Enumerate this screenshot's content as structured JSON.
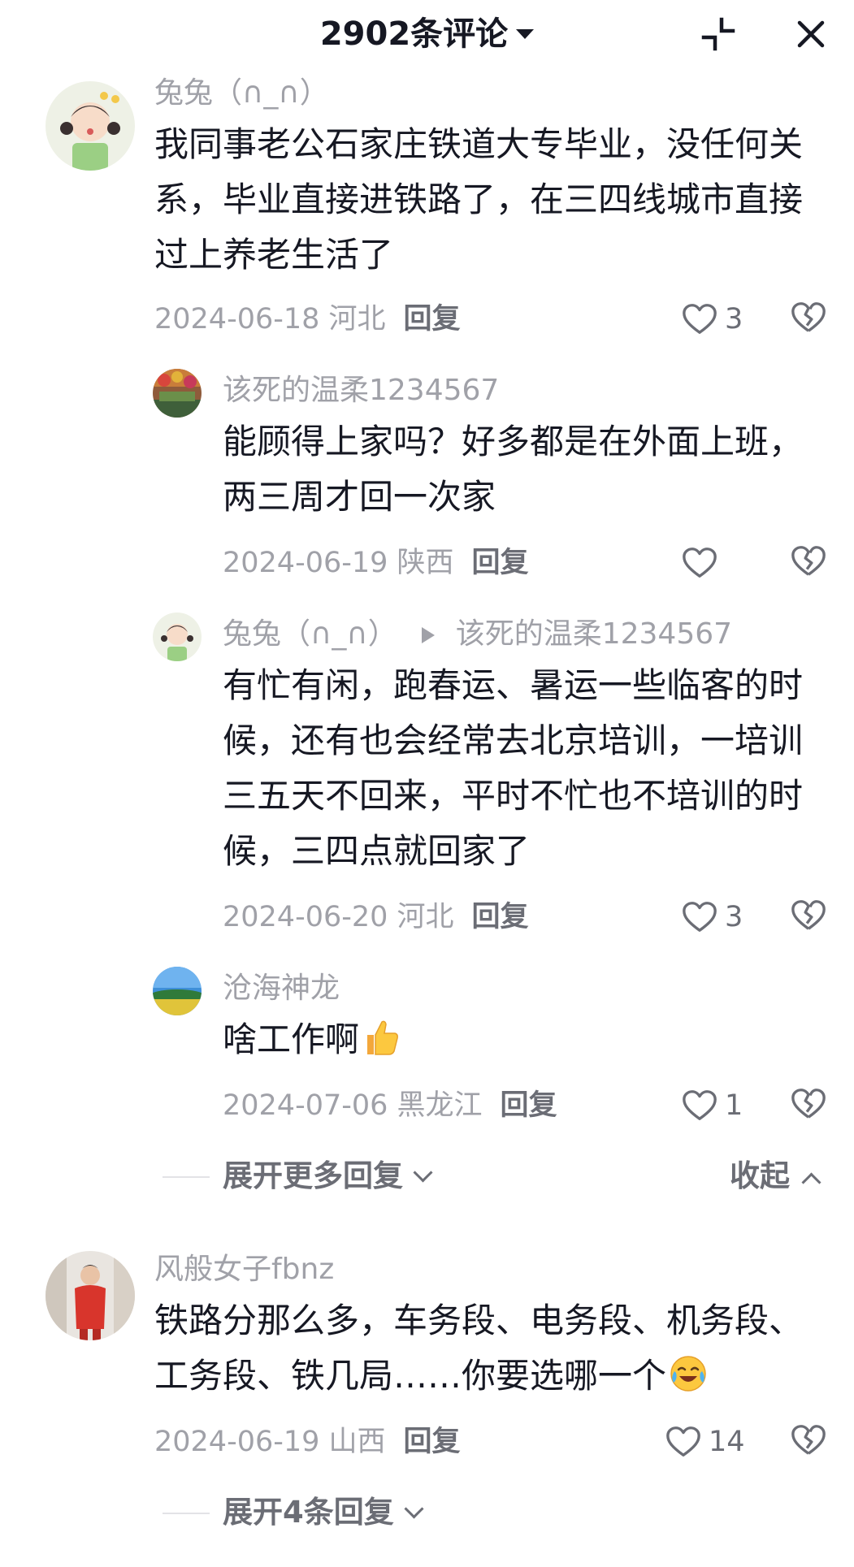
{
  "header": {
    "title": "2902条评论",
    "dropdown_icon": "caret-down-icon",
    "minimize_icon": "minimize-icon",
    "close_icon": "close-icon"
  },
  "comments": [
    {
      "user": "兔兔（∩_∩）",
      "text": "我同事老公石家庄铁道大专毕业，没任何关系，毕业直接进铁路了，在三四线城市直接过上养老生活了",
      "date_loc": "2024-06-18 河北",
      "reply_label": "回复",
      "likes": "3",
      "replies": [
        {
          "user": "该死的温柔1234567",
          "text": "能顾得上家吗？好多都是在外面上班，两三周才回一次家",
          "date_loc": "2024-06-19 陕西",
          "reply_label": "回复",
          "likes": ""
        },
        {
          "user": "兔兔（∩_∩）",
          "reply_to": "该死的温柔1234567",
          "text": "有忙有闲，跑春运、暑运一些临客的时候，还有也会经常去北京培训，一培训三五天不回来，平时不忙也不培训的时候，三四点就回家了",
          "date_loc": "2024-06-20 河北",
          "reply_label": "回复",
          "likes": "3"
        },
        {
          "user": "沧海神龙",
          "text": "啥工作啊",
          "emoji": "thumbs-up-emoji",
          "date_loc": "2024-07-06 黑龙江",
          "reply_label": "回复",
          "likes": "1"
        }
      ],
      "expand_label": "展开更多回复",
      "collapse_label": "收起"
    },
    {
      "user": "风般女子fbnz",
      "text": "铁路分那么多，车务段、电务段、机务段、工务段、铁几局……你要选哪一个",
      "emoji": "laughing-tears-emoji",
      "date_loc": "2024-06-19 山西",
      "reply_label": "回复",
      "likes": "14",
      "expand_label": "展开4条回复"
    }
  ],
  "colors": {
    "primary_text": "#161823",
    "secondary_text": "#a0a1a8",
    "action_text": "#6b6d75"
  }
}
